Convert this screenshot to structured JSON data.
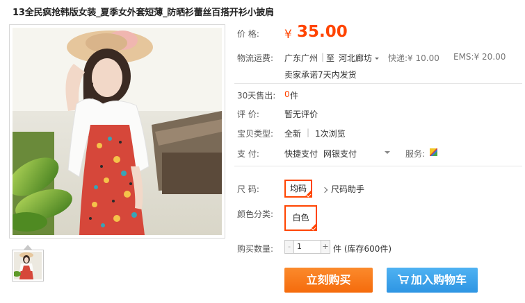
{
  "title": "13全民疯抢韩版女装_夏季女外套短薄_防晒衫蕾丝百搭开衫小披肩",
  "price": {
    "label": "价    格:",
    "currency": "¥",
    "value": "35.00"
  },
  "shipping": {
    "label": "物流运费:",
    "from": "广东广州",
    "sep": "|",
    "to_prefix": "至",
    "to": "河北廊坊",
    "express": "快递:¥ 10.00",
    "ems": "EMS:¥ 20.00",
    "promise": "卖家承诺7天内发货"
  },
  "sales": {
    "label": "30天售出:",
    "count": "0",
    "unit": "件"
  },
  "review": {
    "label": "评    价:",
    "value": "暂无评价"
  },
  "item_type": {
    "label": "宝贝类型:",
    "condition": "全新",
    "sep": "|",
    "views": "1次浏览"
  },
  "payment": {
    "label": "支    付:",
    "method1": "快捷支付",
    "method2": "网银支付",
    "service_label": "服务:"
  },
  "size": {
    "label": "尺    码:",
    "option": "均码",
    "help": "尺码助手"
  },
  "color": {
    "label": "颜色分类:",
    "option": "白色"
  },
  "quantity": {
    "label": "购买数量:",
    "value": "1",
    "minus": "-",
    "plus": "+",
    "stock": "件 (库存600件)"
  },
  "actions": {
    "buy": "立刻购买",
    "cart": "加入购物车"
  },
  "colors": {
    "accent": "#ff4400",
    "buy_button": "#f56b0c",
    "cart_button": "#2e95e3"
  }
}
